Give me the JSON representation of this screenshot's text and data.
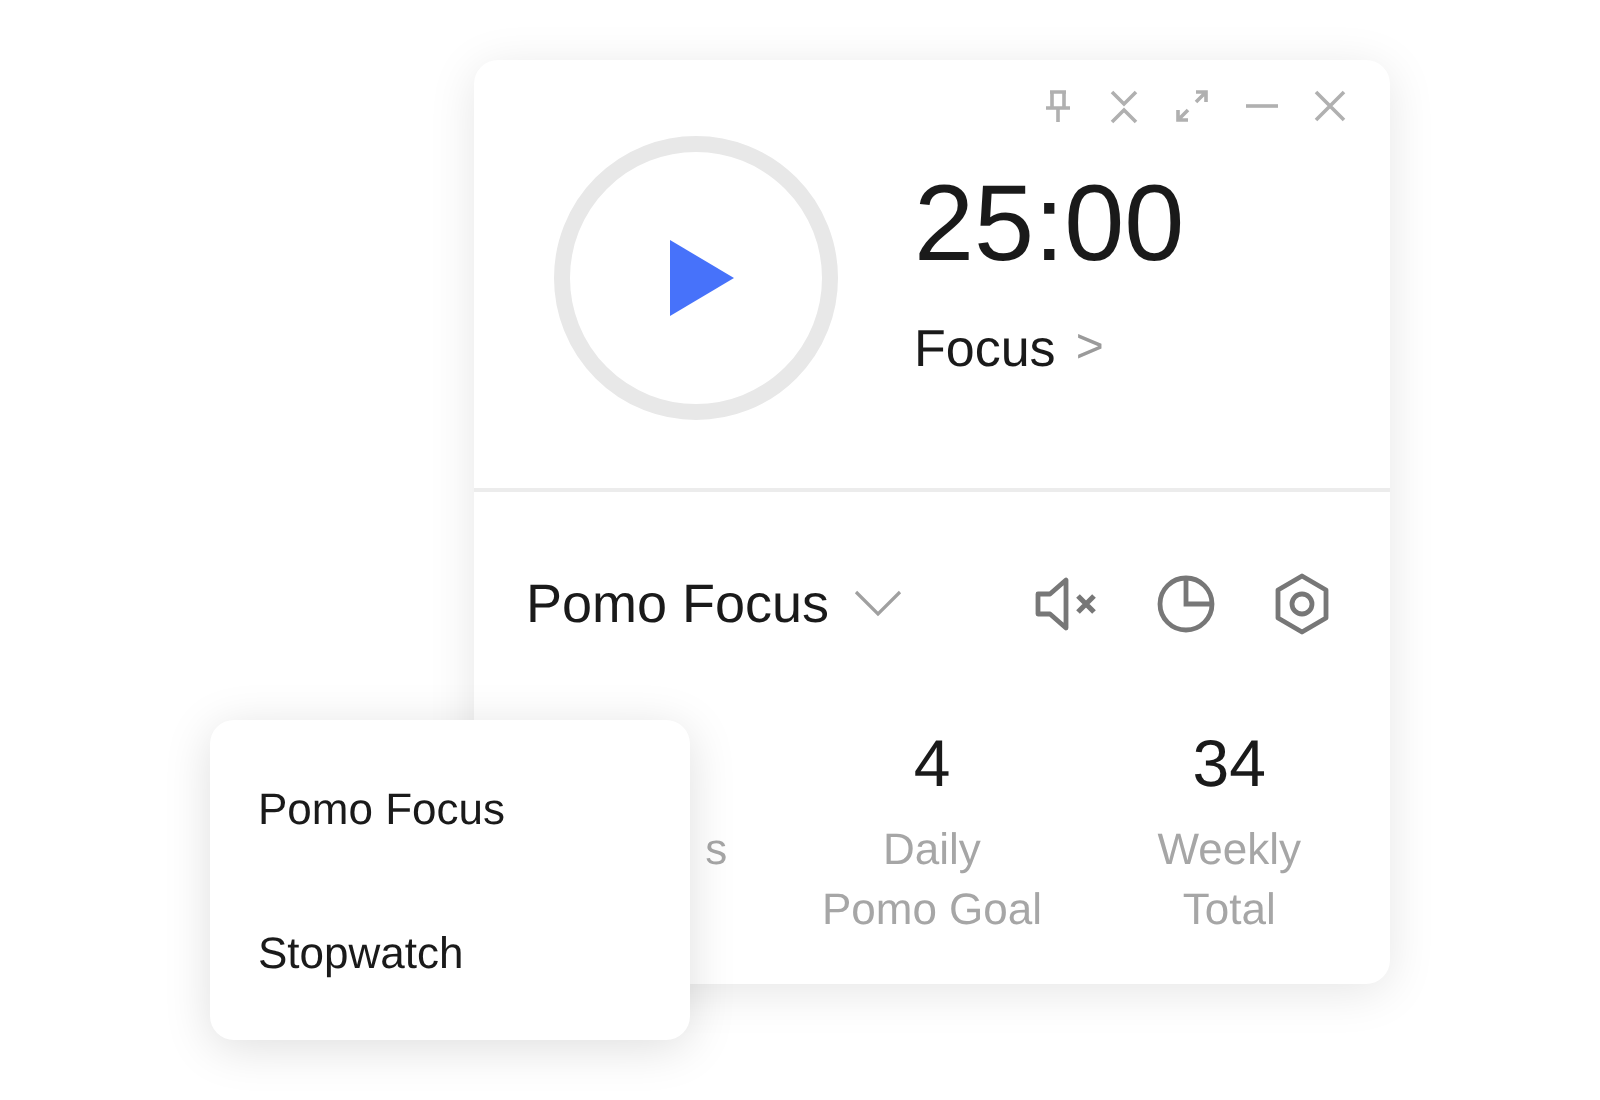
{
  "timer": {
    "time": "25:00",
    "mode_label": "Focus",
    "chevron": ">"
  },
  "mode_selector": {
    "label": "Pomo Focus",
    "expanded": true
  },
  "sound": {
    "muted": true
  },
  "stats": [
    {
      "label": [
        "s"
      ]
    },
    {
      "value": "4",
      "label": [
        "Daily",
        "Pomo Goal"
      ]
    },
    {
      "value": "34",
      "label": [
        "Weekly",
        "Total"
      ]
    }
  ],
  "menu": [
    {
      "label": "Pomo Focus"
    },
    {
      "label": "Stopwatch"
    }
  ]
}
